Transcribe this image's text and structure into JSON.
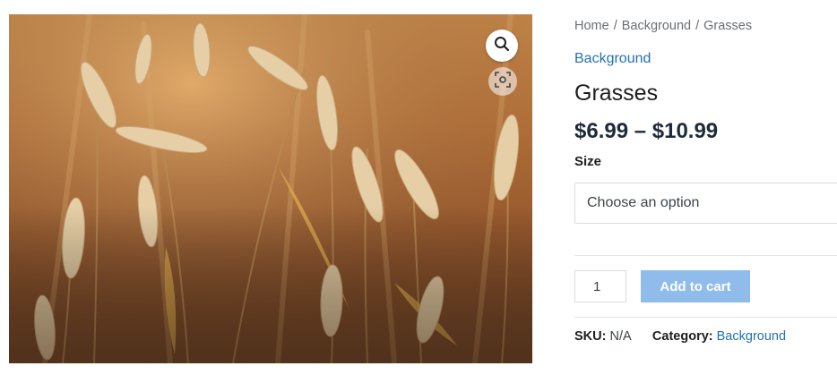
{
  "breadcrumb": {
    "items": [
      "Home",
      "Background",
      "Grasses"
    ],
    "separator": "/"
  },
  "product": {
    "category_link": "Background",
    "title": "Grasses",
    "price": "$6.99 – $10.99",
    "variation": {
      "label": "Size",
      "placeholder": "Choose an option"
    },
    "quantity": "1",
    "add_to_cart_label": "Add to cart",
    "meta": {
      "sku_label": "SKU:",
      "sku_value": "N/A",
      "category_label": "Category:",
      "category_value": "Background"
    }
  },
  "gallery": {
    "image_subject": "golden foxtail grasses at sunset",
    "zoom_icon": "magnifier-icon",
    "scan_icon": "image-scan-icon"
  },
  "colors": {
    "link": "#2271b1",
    "button_bg": "#8fbcea",
    "price": "#1d2b3a"
  }
}
